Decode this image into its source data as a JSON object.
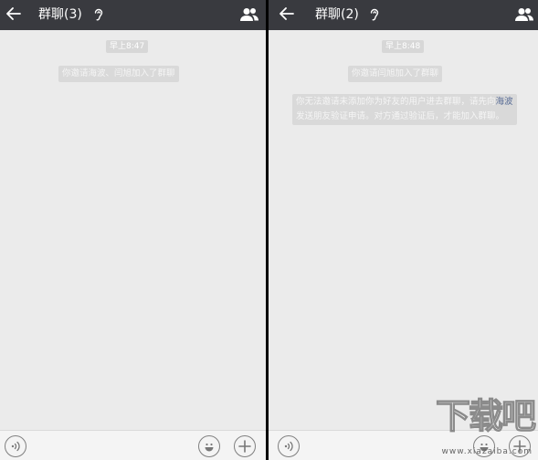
{
  "left": {
    "title": "群聊(3)",
    "time": "早上8:47",
    "system_message": "你邀请海波、闫旭加入了群聊"
  },
  "right": {
    "title": "群聊(2)",
    "time": "早上8:48",
    "system_message": "你邀请闫旭加入了群聊",
    "warning": {
      "part1": "你无法邀请未添加你为好友的用户进去群聊，请先向",
      "name": "海波",
      "part2": "发送朋友验证申请。对方通过验证后，才能加入群聊。"
    }
  },
  "watermark": {
    "logo": "下载吧",
    "url": "www.xiazaiba.com"
  },
  "icons": {
    "back": "back-arrow-icon",
    "earpiece": "ear-icon",
    "group_info": "people-icon",
    "voice": "voice-icon",
    "emoji": "emoji-icon",
    "more": "plus-icon"
  },
  "colors": {
    "header": "#393a3f",
    "chat_bg": "#ebebeb",
    "link": "#576b95"
  }
}
